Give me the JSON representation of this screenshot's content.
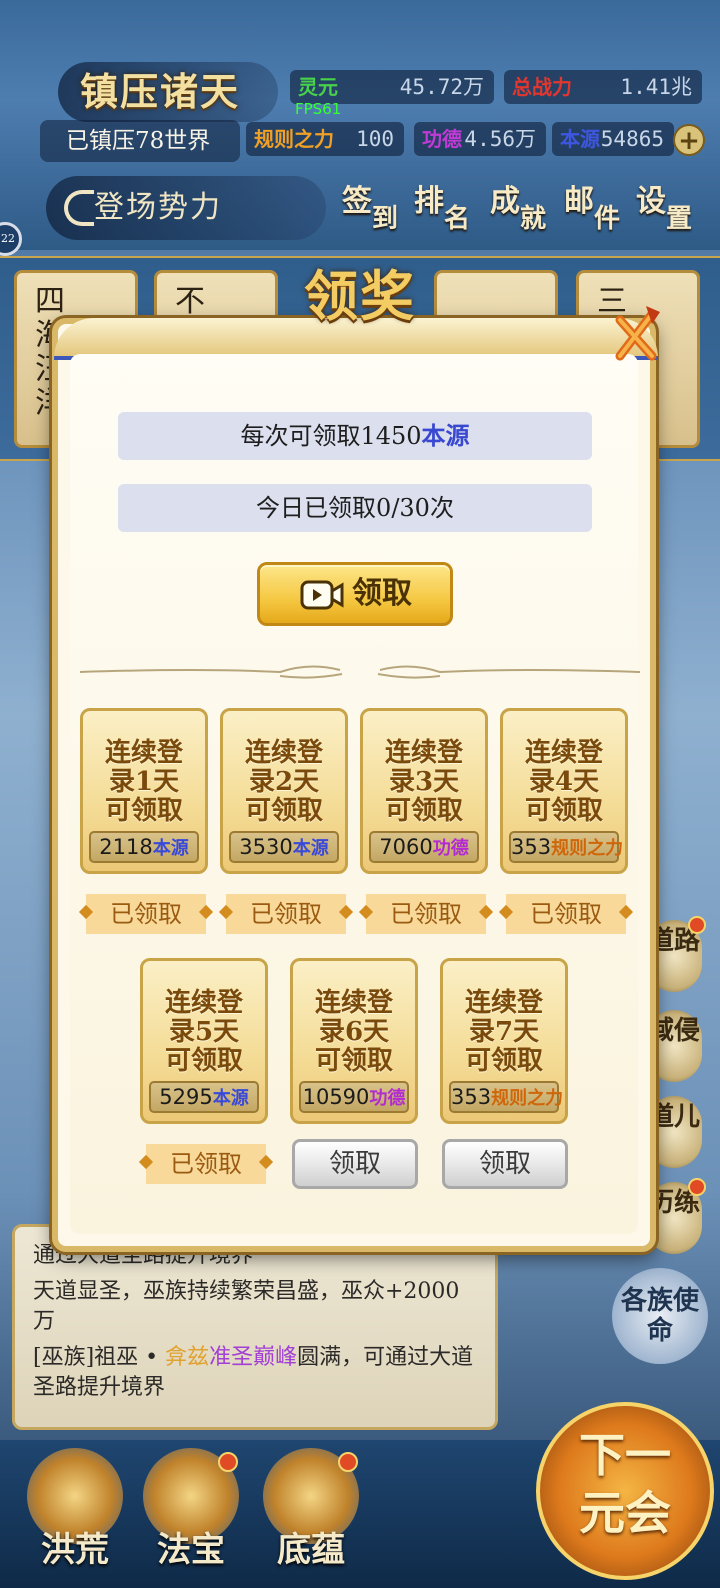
{
  "header": {
    "sect_name": "镇压诸天",
    "suppressed_worlds": "已镇压78世界",
    "faction_button": "登场势力",
    "fps": "FPS61",
    "stats": [
      {
        "label": "灵元",
        "value": "45.72万",
        "color": "#48d24a"
      },
      {
        "label": "总战力",
        "value": "1.41兆",
        "color": "#e3362e"
      },
      {
        "label": "规则之力",
        "value": "100",
        "color": "#f0a024"
      },
      {
        "label": "功德",
        "value": "4.56万",
        "color": "#c03bd6"
      },
      {
        "label": "本源",
        "value": "54865",
        "color": "#3f57e0"
      }
    ],
    "nav": [
      {
        "c1": "签",
        "c2": "到"
      },
      {
        "c1": "排",
        "c2": "名"
      },
      {
        "c1": "成",
        "c2": "就"
      },
      {
        "c1": "邮",
        "c2": "件"
      },
      {
        "c1": "设",
        "c2": "置"
      }
    ],
    "left_ring": "22"
  },
  "background_cards": [
    {
      "text": "四\n海\n汪\n洋"
    },
    {
      "text": "不"
    },
    {
      "text": ""
    },
    {
      "text": "三\n玄\n门"
    }
  ],
  "modal": {
    "title": "领奖",
    "per_claim_prefix": "每次可领取1450",
    "per_claim_resource": "本源",
    "today_count": "今日已领取0/30次",
    "claim_button": "领取",
    "days": [
      {
        "title": "连续登录1天可领取",
        "amount": "2118",
        "resource": "本源",
        "res_color": "blue",
        "status": "已领取",
        "claimed": true
      },
      {
        "title": "连续登录2天可领取",
        "amount": "3530",
        "resource": "本源",
        "res_color": "blue",
        "status": "已领取",
        "claimed": true
      },
      {
        "title": "连续登录3天可领取",
        "amount": "7060",
        "resource": "功德",
        "res_color": "purple",
        "status": "已领取",
        "claimed": true
      },
      {
        "title": "连续登录4天可领取",
        "amount": "353",
        "resource": "规则之力",
        "res_color": "orange",
        "status": "已领取",
        "claimed": true
      },
      {
        "title": "连续登录5天可领取",
        "amount": "5295",
        "resource": "本源",
        "res_color": "blue",
        "status": "已领取",
        "claimed": true
      },
      {
        "title": "连续登录6天可领取",
        "amount": "10590",
        "resource": "功德",
        "res_color": "purple",
        "status": "领取",
        "claimed": false
      },
      {
        "title": "连续登录7天可领取",
        "amount": "353",
        "resource": "规则之力",
        "res_color": "orange",
        "status": "领取",
        "claimed": false
      }
    ]
  },
  "info_panel": {
    "line1": "通过大道圣路提升境界",
    "line2": "天道显圣，巫族持续繁荣昌盛，巫众+2000万",
    "line3_a": "[巫族]祖巫 • ",
    "line3_name": "弇兹",
    "line3_rank": "准圣巅峰",
    "line3_b": "圆满，可通过大道圣路提升境界"
  },
  "side_buttons": [
    {
      "label": "道路"
    },
    {
      "label": "域侵"
    },
    {
      "label": "道儿"
    },
    {
      "label": "历练"
    }
  ],
  "mission_button": "各族使命",
  "bottom_tabs": [
    {
      "label": "洪荒"
    },
    {
      "label": "法宝"
    },
    {
      "label": "底蕴"
    }
  ],
  "next_era": "下一元会"
}
